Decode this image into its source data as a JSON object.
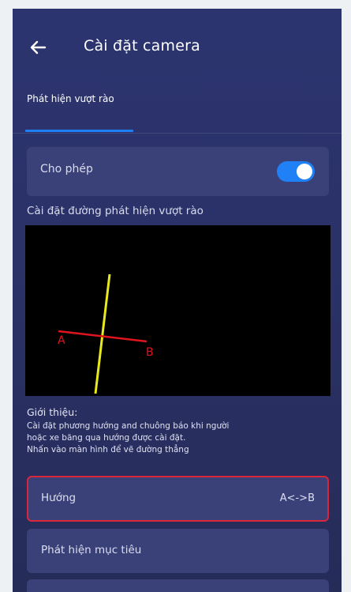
{
  "header": {
    "title": "Cài đặt camera",
    "back_icon": "arrow-left-icon"
  },
  "tabs": [
    {
      "label": "Phát hiện vượt rào",
      "active": true
    }
  ],
  "enable": {
    "label": "Cho phép",
    "on": true
  },
  "line_setting": {
    "label": "Cài đặt đường phát hiện vượt rào",
    "point_a": "A",
    "point_b": "B"
  },
  "intro": {
    "title": "Giới thiệu:",
    "lines": [
      "Cài đặt phương hướng and chuông báo khi người",
      "hoặc xe băng qua hướng được cài đặt.",
      "Nhấn vào màn hình để vẽ đường thẳng"
    ]
  },
  "direction": {
    "label": "Hướng",
    "value": "A<->B"
  },
  "target_detection": {
    "label": "Phát hiện mục tiêu"
  },
  "colors": {
    "accent": "#1f81f5",
    "highlight_border": "#d9263b",
    "fence_line": "#e8e81c",
    "direction_line": "#e0141e"
  }
}
